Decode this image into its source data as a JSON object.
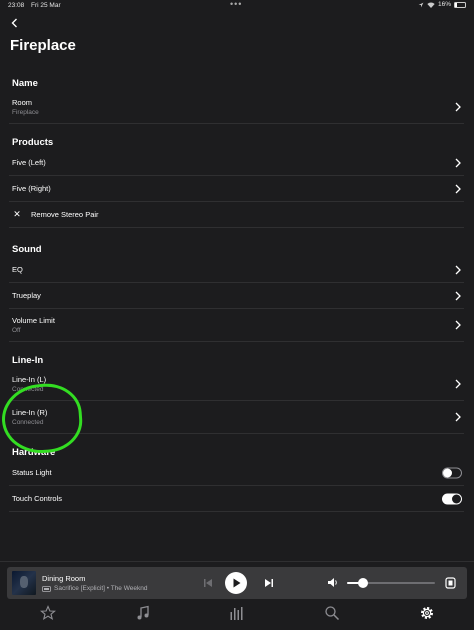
{
  "status": {
    "time": "23:08",
    "date": "Fri 25 Mar",
    "battery": "16%",
    "battery_level": 0.16
  },
  "header": {
    "title": "Fireplace"
  },
  "sections": {
    "name": {
      "title": "Name",
      "room_label": "Room",
      "room_value": "Fireplace"
    },
    "products": {
      "title": "Products",
      "five_left": "Five (Left)",
      "five_right": "Five (Right)",
      "remove_stereo": "Remove Stereo Pair"
    },
    "sound": {
      "title": "Sound",
      "eq": "EQ",
      "trueplay": "Trueplay",
      "volume_limit": "Volume Limit",
      "volume_limit_value": "Off"
    },
    "line_in": {
      "title": "Line-In",
      "left_label": "Line-In (L)",
      "left_status": "Connected",
      "right_label": "Line-In (R)",
      "right_status": "Connected"
    },
    "hardware": {
      "title": "Hardware",
      "status_light": "Status Light",
      "status_light_on": false,
      "touch_controls": "Touch Controls",
      "touch_controls_on": true
    }
  },
  "now_playing": {
    "room": "Dining Room",
    "track": "Sacrifice [Explicit] • The Weeknd",
    "volume_level": 0.18
  },
  "tabs": [
    "favorites-icon",
    "music-icon",
    "rooms-icon",
    "search-icon",
    "settings-icon"
  ],
  "colors": {
    "background": "#1c1c1e",
    "player": "#3a3a3c",
    "highlight": "#33dd22",
    "muted_text": "#8e8e93"
  }
}
